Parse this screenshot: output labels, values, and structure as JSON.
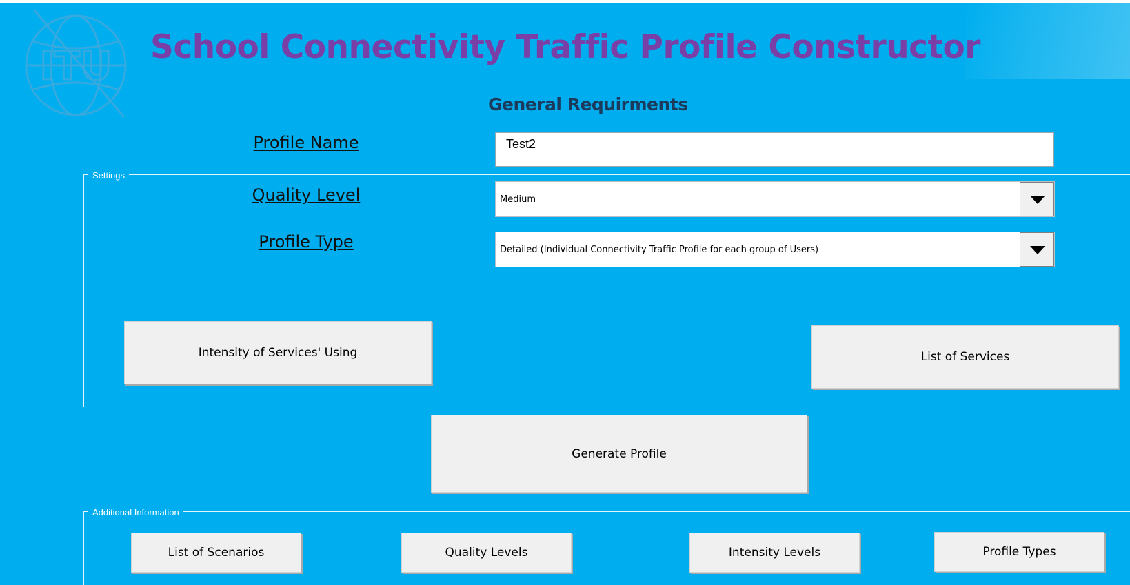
{
  "header": {
    "title": "School Connectivity Traffic Profile Constructor",
    "subtitle": "General Requirments",
    "logo_text": "ITU"
  },
  "fields": {
    "profile_name_label": "Profile Name",
    "profile_name_value": "Test2",
    "quality_level_label": "Quality Level",
    "quality_level_value": "Medium",
    "profile_type_label": "Profile Type",
    "profile_type_value": "Detailed (Individual Connectivity Traffic Profile for each group of Users)"
  },
  "settings": {
    "caption": "Settings",
    "intensity_button": "Intensity of Services' Using",
    "list_services_button": "List of Services"
  },
  "generate_button": "Generate Profile",
  "additional": {
    "caption": "Additional Information",
    "buttons": [
      "List of Scenarios",
      "Quality Levels",
      "Intensity Levels",
      "Profile Types"
    ]
  },
  "colors": {
    "background": "#00aeef",
    "title": "#7a3fa6",
    "subtitle": "#1b3a5c",
    "button": "#f0f0f0"
  },
  "icons": {
    "logo": "itu-logo-icon",
    "dropdown": "dropdown-arrow-icon"
  }
}
